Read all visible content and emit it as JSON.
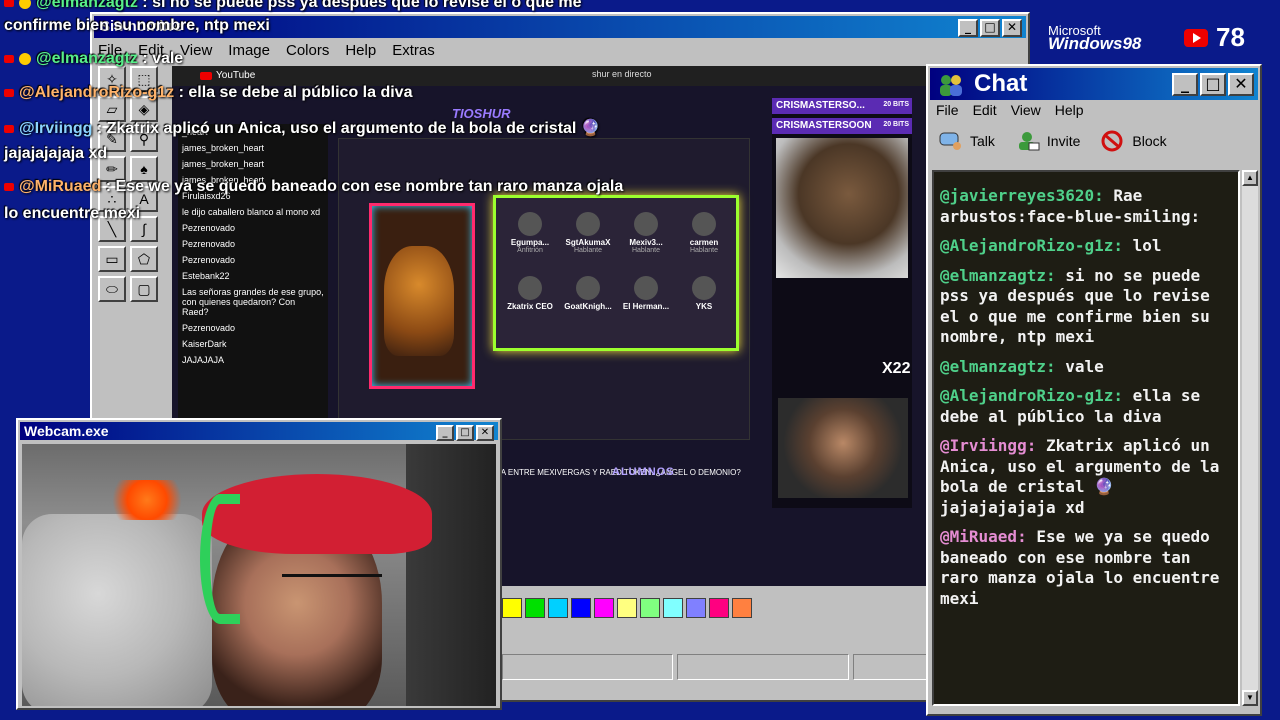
{
  "paint": {
    "title": "Sin nombre",
    "menu": [
      "File",
      "Edit",
      "View",
      "Image",
      "Colors",
      "Help",
      "Extras"
    ],
    "palette": [
      "#ffff00",
      "#00e000",
      "#00d0ff",
      "#0000ff",
      "#ff00ff",
      "#ffff80",
      "#80ff80",
      "#80ffff",
      "#8080ff",
      "#ff0080",
      "#ff8040"
    ]
  },
  "browser": {
    "app": "YouTube",
    "search": "shur en directo",
    "channel_logo": "TIOSHUR",
    "chat_lines": [
      "_heart",
      "james_broken_heart",
      "james_broken_heart",
      "james_broken_heart",
      "Firulaisxd26",
      "le dijo caballero blanco al mono xd",
      "Pezrenovado",
      "Pezrenovado",
      "Pezrenovado",
      "Estebank22",
      "Las señoras grandes de ese grupo, con quienes quedaron? Con Raed?",
      "Pezrenovado",
      "KaiserDark",
      "JAJAJAJA"
    ],
    "guests": [
      {
        "name": "Egumpa...",
        "sub": "Anfitrión"
      },
      {
        "name": "SgtAkumaX",
        "sub": "Hablante"
      },
      {
        "name": "Mexiv3...",
        "sub": "Hablante"
      },
      {
        "name": "carmen",
        "sub": "Hablante"
      },
      {
        "name": "Zkatrix CEO",
        "sub": ""
      },
      {
        "name": "GoatKnigh...",
        "sub": ""
      },
      {
        "name": "El Herman...",
        "sub": ""
      },
      {
        "name": "YKS",
        "sub": ""
      }
    ],
    "video_title": "AYAX GALLO: LA QUE INICIO LA GUERRA ENTRE MEXIVERGAS Y RAED TOKEN. ¿ANGEL O DEMONIO?",
    "overlay_label": "ALUMNOS",
    "donor_1": "CRISMASTERSO...",
    "donor_2": "CRISMASTERSOON",
    "bits_1": "20 BITS",
    "bits_2": "20 BITS",
    "multiplier": "X22"
  },
  "overlay_chat": [
    {
      "user": "@elmanzagtz",
      "text": " : si no se puede pss ya después que lo revise el o que me",
      "badge": true
    },
    {
      "user": "",
      "text": "confirme bien su nombre, ntp mexi",
      "badge": false
    },
    {
      "user": "@elmanzagtz",
      "text": " : vale",
      "badge": true
    },
    {
      "user": "@AlejandroRizo-g1z",
      "text": " : ella se debe al público la diva",
      "badge": false
    },
    {
      "user": "@Irviingg",
      "text": " : Zkatrix aplicó un Anica, uso el argumento de la bola de cristal 🔮",
      "badge": false
    },
    {
      "user": "",
      "text": "jajajajajaja xd",
      "badge": false
    },
    {
      "user": "@MiRuaed",
      "text": " : Ese we ya se quedo baneado con ese nombre tan raro manza ojala",
      "badge": false
    },
    {
      "user": "",
      "text": "lo encuentre mexi",
      "badge": false
    }
  ],
  "branding": {
    "microsoft": "Microsoft",
    "windows": "Windows98",
    "viewer_count": "78"
  },
  "chat": {
    "title": "Chat",
    "menu": [
      "File",
      "Edit",
      "View",
      "Help"
    ],
    "toolbar": {
      "talk": "Talk",
      "invite": "Invite",
      "block": "Block"
    },
    "messages": [
      {
        "user": "@javierreyes3620:",
        "text": " Rae arbustos:face-blue-smiling:"
      },
      {
        "user": "@AlejandroRizo-g1z:",
        "text": " lol"
      },
      {
        "user": "@elmanzagtz:",
        "text": " si no se puede pss ya después que lo revise el o que me confirme bien su nombre, ntp mexi"
      },
      {
        "user": "@elmanzagtz:",
        "text": " vale"
      },
      {
        "user": "@AlejandroRizo-g1z:",
        "text": " ella se debe al público la diva"
      },
      {
        "user": "@Irviingg:",
        "text": " Zkatrix aplicó un Anica, uso el argumento de la bola de cristal 🔮 jajajajajaja xd"
      },
      {
        "user": "@MiRuaed:",
        "text": " Ese we ya se quedo baneado con ese nombre tan raro manza ojala lo encuentre mexi"
      }
    ]
  },
  "webcam": {
    "title": "Webcam.exe"
  }
}
